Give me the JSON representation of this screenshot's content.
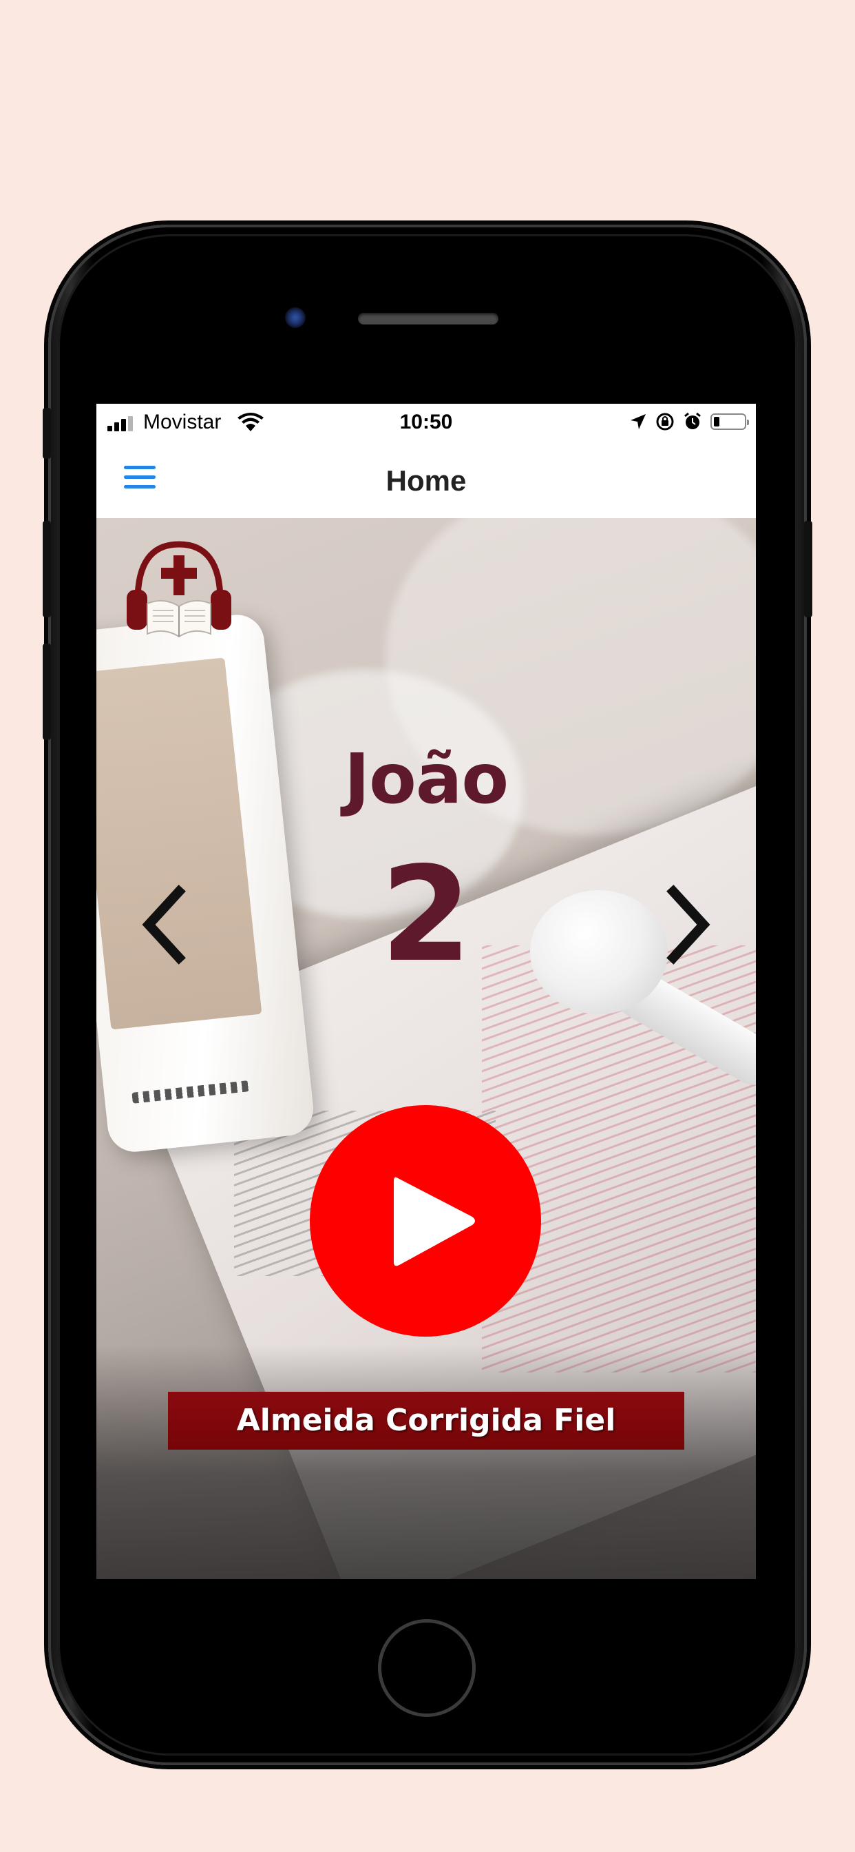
{
  "status_bar": {
    "carrier": "Movistar",
    "time": "10:50",
    "battery_level": 0.2
  },
  "nav": {
    "title": "Home",
    "menu_icon": "hamburger-menu-icon"
  },
  "player": {
    "book": "João",
    "chapter": "2",
    "version": "Almeida Corrigida Fiel",
    "prev_icon": "chevron-left-icon",
    "next_icon": "chevron-right-icon",
    "play_icon": "play-icon"
  },
  "colors": {
    "background": "#fae8e1",
    "menu_accent": "#2385e8",
    "title_color": "#5e1a2c",
    "play_button": "#ff0000",
    "banner": "#8a0a0f"
  }
}
